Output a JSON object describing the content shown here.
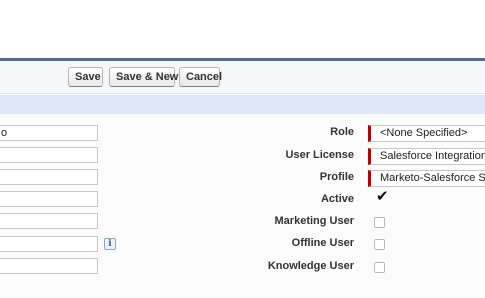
{
  "toolbar": {
    "save_label": "Save",
    "save_new_label": "Save & New",
    "cancel_label": "Cancel"
  },
  "left_fields": [
    {
      "value": "o"
    },
    {
      "value": ""
    },
    {
      "value": ""
    },
    {
      "value": ""
    },
    {
      "value": ""
    },
    {
      "value": ""
    },
    {
      "value": ""
    }
  ],
  "info_icon_glyph": "i",
  "right_fields": {
    "role": {
      "label": "Role",
      "value": "<None Specified>"
    },
    "user_license": {
      "label": "User License",
      "value": "Salesforce Integration"
    },
    "profile": {
      "label": "Profile",
      "value": "Marketo-Salesforce Sy"
    },
    "active": {
      "label": "Active",
      "checked": true,
      "check_glyph": "✔"
    },
    "marketing_user": {
      "label": "Marketing User",
      "checked": false
    },
    "offline_user": {
      "label": "Offline User",
      "checked": false
    },
    "knowledge_user": {
      "label": "Knowledge User",
      "checked": false
    }
  },
  "colors": {
    "required_indicator": "#c00000",
    "section_bar": "#dfe7f5",
    "top_border": "#5a6c84"
  }
}
